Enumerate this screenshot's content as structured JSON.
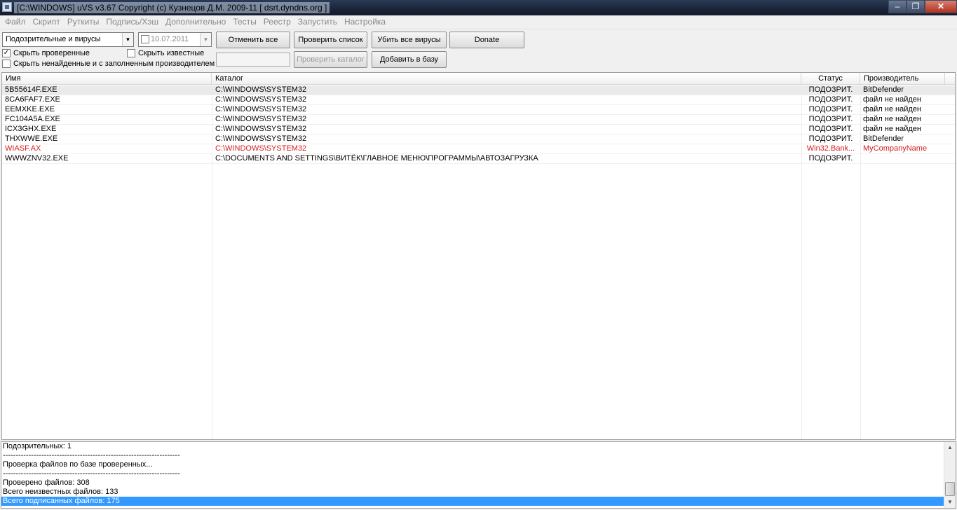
{
  "window": {
    "title": "[C:\\WINDOWS] uVS v3.67 Copyright (c) Кузнецов Д.М. 2009-11 [ dsrt.dyndns.org ]",
    "minimize_icon": "minimize-icon",
    "maximize_icon": "restore-icon",
    "close_icon": "close-icon"
  },
  "menu": [
    "Файл",
    "Скрипт",
    "Руткиты",
    "Подпись/Хэш",
    "Дополнительно",
    "Тесты",
    "Реестр",
    "Запустить",
    "Настройка"
  ],
  "toolbar": {
    "filter_select": "Подозрительные и вирусы",
    "date_value": "10.07.2011",
    "cancel_all": "Отменить все",
    "check_list": "Проверить список",
    "kill_viruses": "Убить все вирусы",
    "donate": "Donate",
    "hide_checked": "Скрыть проверенные",
    "hide_checked_state": true,
    "hide_known": "Скрыть известные",
    "hide_known_state": false,
    "hide_not_found": "Скрыть ненайденные и с заполненным производителем",
    "hide_not_found_state": false,
    "check_folder": "Проверить каталог",
    "add_to_db": "Добавить в базу"
  },
  "table": {
    "columns": [
      "Имя",
      "Каталог",
      "Статус",
      "Производитель"
    ],
    "rows": [
      {
        "name": "5B55614F.EXE",
        "path": "C:\\WINDOWS\\SYSTEM32",
        "status": "ПОДОЗРИТ.",
        "vendor": "BitDefender"
      },
      {
        "name": "8CA6FAF7.EXE",
        "path": "C:\\WINDOWS\\SYSTEM32",
        "status": "ПОДОЗРИТ.",
        "vendor": "файл не найден"
      },
      {
        "name": "EEMXKE.EXE",
        "path": "C:\\WINDOWS\\SYSTEM32",
        "status": "ПОДОЗРИТ.",
        "vendor": "файл не найден"
      },
      {
        "name": "FC104A5A.EXE",
        "path": "C:\\WINDOWS\\SYSTEM32",
        "status": "ПОДОЗРИТ.",
        "vendor": "файл не найден"
      },
      {
        "name": "ICX3GHX.EXE",
        "path": "C:\\WINDOWS\\SYSTEM32",
        "status": "ПОДОЗРИТ.",
        "vendor": "файл не найден"
      },
      {
        "name": "THXWWE.EXE",
        "path": "C:\\WINDOWS\\SYSTEM32",
        "status": "ПОДОЗРИТ.",
        "vendor": "BitDefender"
      },
      {
        "name": "WIASF.AX",
        "path": "C:\\WINDOWS\\SYSTEM32",
        "status": "Win32.Bank...",
        "vendor": "MyCompanyName"
      },
      {
        "name": "WWWZNV32.EXE",
        "path": "C:\\DOCUMENTS AND SETTINGS\\ВИТЁК\\ГЛАВНОЕ МЕНЮ\\ПРОГРАММЫ\\АВТОЗАГРУЗКА",
        "status": "ПОДОЗРИТ.",
        "vendor": ""
      }
    ]
  },
  "log": [
    "Подозрительных: 1",
    "---------------------------------------------------------------------",
    "Проверка файлов по базе проверенных...",
    "---------------------------------------------------------------------",
    "Проверено файлов: 308",
    "Всего неизвестных файлов: 133",
    "Всего подписанных файлов: 175"
  ],
  "colors": {
    "danger": "#d42020",
    "highlight": "#3399ff"
  }
}
